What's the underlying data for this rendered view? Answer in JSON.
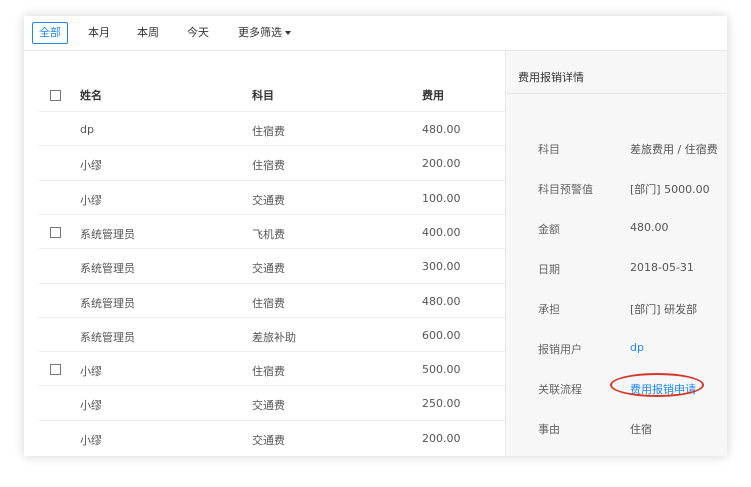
{
  "filters": {
    "tabs": [
      "全部",
      "本月",
      "本周",
      "今天"
    ],
    "more_label": "更多筛选",
    "active": "全部"
  },
  "table": {
    "headers": [
      "姓名",
      "科目",
      "费用"
    ],
    "rows": [
      {
        "name": "dp",
        "subject": "住宿费",
        "amount": "480.00",
        "checkbox": false
      },
      {
        "name": "小缪",
        "subject": "住宿费",
        "amount": "200.00",
        "checkbox": false
      },
      {
        "name": "小缪",
        "subject": "交通费",
        "amount": "100.00",
        "checkbox": false
      },
      {
        "name": "系统管理员",
        "subject": "飞机费",
        "amount": "400.00",
        "checkbox": true
      },
      {
        "name": "系统管理员",
        "subject": "交通费",
        "amount": "300.00",
        "checkbox": false
      },
      {
        "name": "系统管理员",
        "subject": "住宿费",
        "amount": "480.00",
        "checkbox": false
      },
      {
        "name": "系统管理员",
        "subject": "差旅补助",
        "amount": "600.00",
        "checkbox": false
      },
      {
        "name": "小缪",
        "subject": "住宿费",
        "amount": "500.00",
        "checkbox": true
      },
      {
        "name": "小缪",
        "subject": "交通费",
        "amount": "250.00",
        "checkbox": false
      },
      {
        "name": "小缪",
        "subject": "交通费",
        "amount": "200.00",
        "checkbox": false
      }
    ]
  },
  "detail": {
    "title": "费用报销详情",
    "fields": [
      {
        "label": "科目",
        "value": "差旅费用 / 住宿费"
      },
      {
        "label": "科目预警值",
        "value": "[部门] 5000.00"
      },
      {
        "label": "金额",
        "value": "480.00"
      },
      {
        "label": "日期",
        "value": "2018-05-31"
      },
      {
        "label": "承担",
        "value": "[部门] 研发部"
      },
      {
        "label": "报销用户",
        "value": "dp",
        "link": true
      },
      {
        "label": "关联流程",
        "value": "费用报销申请",
        "link": true,
        "highlight": true
      },
      {
        "label": "事由",
        "value": "住宿"
      }
    ]
  },
  "colors": {
    "accent": "#1e88e5",
    "highlight": "#d9362b"
  }
}
